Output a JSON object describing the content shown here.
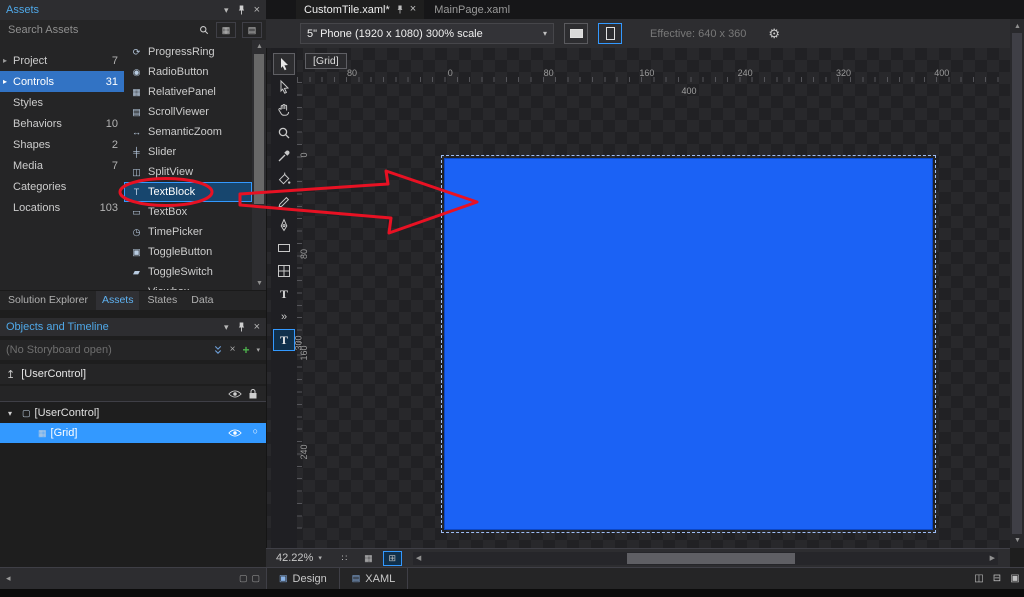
{
  "colors": {
    "accent": "#3399ff",
    "selection": "#3273c4",
    "panel_title": "#4fa8e8",
    "annotation_red": "#e81123",
    "artboard_blue": "#1b62f5"
  },
  "assets_panel": {
    "title": "Assets",
    "search_placeholder": "Search Assets",
    "categories": [
      {
        "label": "Project",
        "count": "7",
        "expander": true
      },
      {
        "label": "Controls",
        "count": "31",
        "expander": true,
        "selected": true
      },
      {
        "label": "Styles",
        "count": ""
      },
      {
        "label": "Behaviors",
        "count": "10"
      },
      {
        "label": "Shapes",
        "count": "2"
      },
      {
        "label": "Media",
        "count": "7"
      },
      {
        "label": "Categories",
        "count": ""
      },
      {
        "label": "Locations",
        "count": "103"
      }
    ],
    "controls": [
      {
        "label": "ProgressRing",
        "icon": "⟳"
      },
      {
        "label": "RadioButton",
        "icon": "◉"
      },
      {
        "label": "RelativePanel",
        "icon": "▦"
      },
      {
        "label": "ScrollViewer",
        "icon": "▤"
      },
      {
        "label": "SemanticZoom",
        "icon": "↔"
      },
      {
        "label": "Slider",
        "icon": "╪"
      },
      {
        "label": "SplitView",
        "icon": "◫"
      },
      {
        "label": "TextBlock",
        "icon": "T",
        "highlighted": true
      },
      {
        "label": "TextBox",
        "icon": "▭"
      },
      {
        "label": "TimePicker",
        "icon": "◷"
      },
      {
        "label": "ToggleButton",
        "icon": "▣"
      },
      {
        "label": "ToggleSwitch",
        "icon": "▰"
      },
      {
        "label": "Viewbox",
        "icon": "▫"
      }
    ],
    "tabs": [
      {
        "label": "Solution Explorer"
      },
      {
        "label": "Assets",
        "active": true
      },
      {
        "label": "States"
      },
      {
        "label": "Data"
      }
    ]
  },
  "objects_panel": {
    "title": "Objects and Timeline",
    "storyboard_placeholder": "(No Storyboard open)",
    "scope_item": "[UserControl]",
    "tree": [
      {
        "label": "[UserControl]",
        "level": 0,
        "icon": "▢",
        "expanded": true
      },
      {
        "label": "[Grid]",
        "level": 1,
        "icon": "▦",
        "selected": true
      }
    ]
  },
  "document_tabs": [
    {
      "label": "CustomTile.xaml*",
      "active": true
    },
    {
      "label": "MainPage.xaml"
    }
  ],
  "device_bar": {
    "device_selector": "5\" Phone (1920 x 1080) 300% scale",
    "effective_label": "Effective: 640 x 360"
  },
  "artboard": {
    "breadcrumb": "[Grid]",
    "width_annotation": "400",
    "height_annotation": "300",
    "h_ruler_labels": [
      "80",
      "0",
      "80",
      "160",
      "240",
      "320",
      "400"
    ],
    "v_ruler_labels": [
      "0",
      "80",
      "160",
      "240"
    ]
  },
  "tools": [
    {
      "name": "selection-tool",
      "boxed": true
    },
    {
      "name": "direct-selection-tool"
    },
    {
      "name": "pan-tool"
    },
    {
      "name": "zoom-tool"
    },
    {
      "name": "eyedropper-tool"
    },
    {
      "name": "paint-bucket-tool"
    },
    {
      "name": "pencil-tool"
    },
    {
      "name": "pen-tool"
    },
    {
      "name": "rectangle-tool"
    },
    {
      "name": "grid-tool"
    },
    {
      "name": "text-tool"
    },
    {
      "name": "more-tools"
    },
    {
      "name": "text-insert-tool",
      "accent": true
    }
  ],
  "design_statusbar": {
    "zoom_level": "42.22%"
  },
  "editor_tabs": [
    {
      "label": "Design"
    },
    {
      "label": "XAML"
    }
  ]
}
